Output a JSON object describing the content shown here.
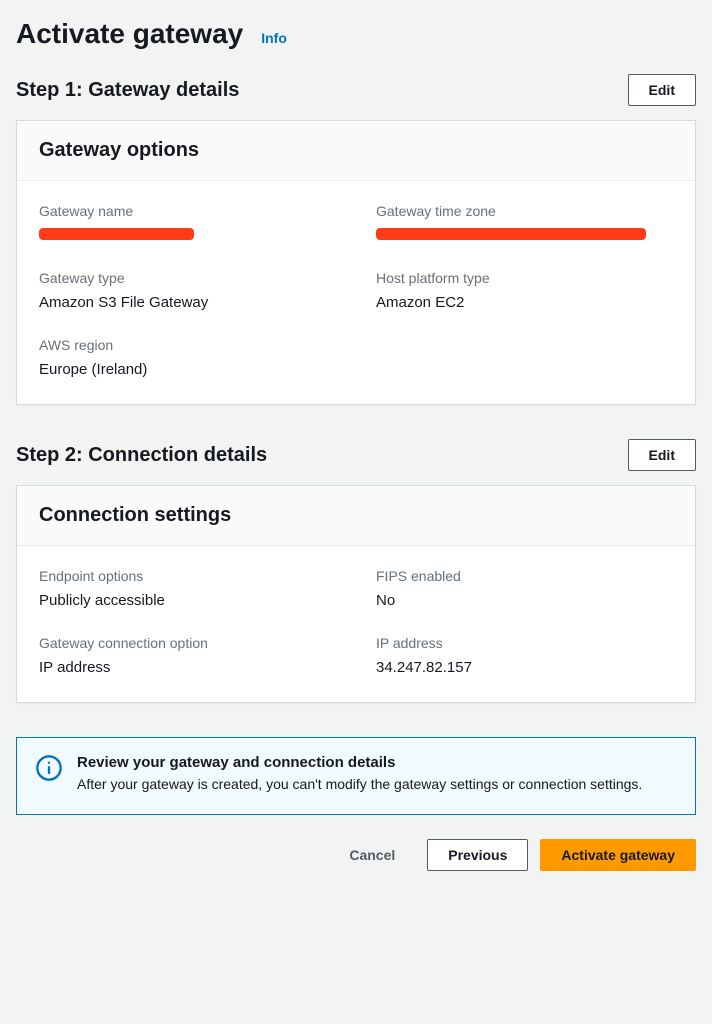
{
  "header": {
    "title": "Activate gateway",
    "info_link": "Info"
  },
  "step1": {
    "title": "Step 1: Gateway details",
    "edit_label": "Edit",
    "panel_title": "Gateway options",
    "fields": {
      "gateway_name_label": "Gateway name",
      "gateway_time_zone_label": "Gateway time zone",
      "gateway_type_label": "Gateway type",
      "gateway_type_value": "Amazon S3 File Gateway",
      "host_platform_type_label": "Host platform type",
      "host_platform_type_value": "Amazon EC2",
      "aws_region_label": "AWS region",
      "aws_region_value": "Europe (Ireland)"
    }
  },
  "step2": {
    "title": "Step 2: Connection details",
    "edit_label": "Edit",
    "panel_title": "Connection settings",
    "fields": {
      "endpoint_options_label": "Endpoint options",
      "endpoint_options_value": "Publicly accessible",
      "fips_enabled_label": "FIPS enabled",
      "fips_enabled_value": "No",
      "gateway_connection_option_label": "Gateway connection option",
      "gateway_connection_option_value": "IP address",
      "ip_address_label": "IP address",
      "ip_address_value": "34.247.82.157"
    }
  },
  "info_box": {
    "title": "Review your gateway and connection details",
    "text": "After your gateway is created, you can't modify the gateway settings or connection settings."
  },
  "footer": {
    "cancel_label": "Cancel",
    "previous_label": "Previous",
    "activate_label": "Activate gateway"
  }
}
